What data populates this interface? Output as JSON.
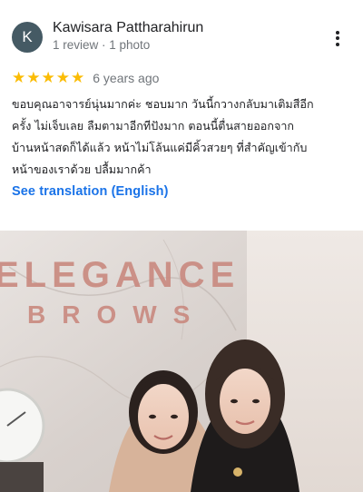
{
  "reviewer": {
    "initial": "K",
    "name": "Kawisara Pattharahirun",
    "meta": "1 review · 1 photo"
  },
  "review": {
    "rating": 5,
    "time": "6 years ago",
    "lines": [
      "ขอบคุณอาจารย์นุ่นมากค่ะ ชอบมาก วันนี้กวางกลับมาเติมสีอีก",
      "ครั้ง ไม่เจ็บเลย ลืมตามาอีกทีปังมาก ตอนนี้ตื่นสายออกจาก",
      "บ้านหน้าสดก็ได้แล้ว หน้าไม่โล้นแค่มีคิ้วสวยๆ ที่สำคัญเข้ากับ",
      "หน้าของเราด้วย ปลื้มมากค้า"
    ],
    "translate_link": "See translation (English)"
  },
  "photo": {
    "sign_line1": "ELEGANCE",
    "sign_line2": "BROWS"
  },
  "colors": {
    "star": "#fbbc04",
    "link": "#1a73e8",
    "avatar": "#455a64",
    "sign": "#c9897f"
  },
  "icons": {
    "more": "more-vert-icon",
    "star": "star-icon"
  }
}
